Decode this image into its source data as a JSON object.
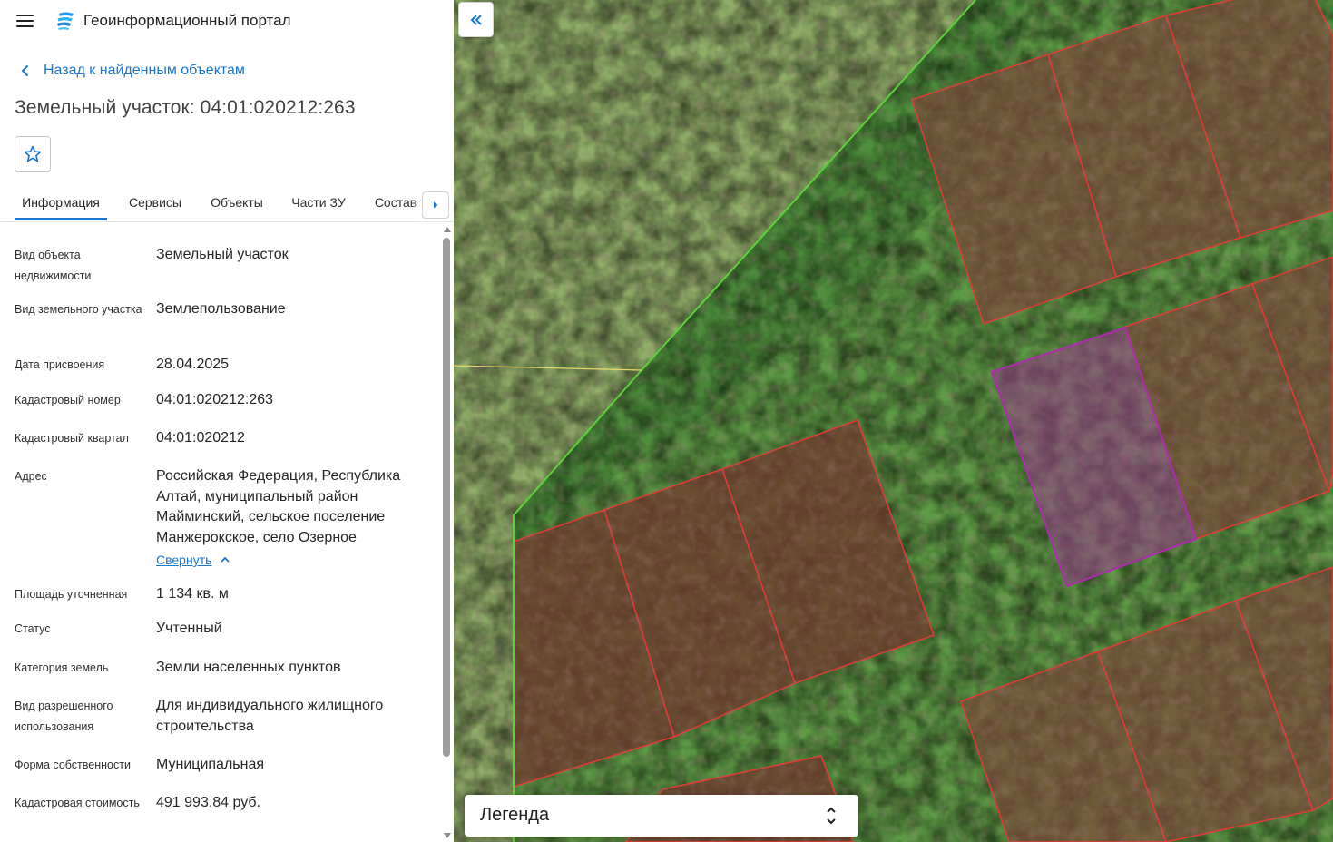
{
  "header": {
    "app_title": "Геоинформационный портал",
    "menu_icon": "hamburger-menu-icon",
    "logo_icon": "portal-logo-icon"
  },
  "nav": {
    "back_label": "Назад к найденным объектам",
    "back_icon": "chevron-left-icon"
  },
  "object": {
    "title": "Земельный участок: 04:01:020212:263",
    "favorite_icon": "star-outline-icon"
  },
  "tabs": [
    {
      "label": "Информация",
      "active": true
    },
    {
      "label": "Сервисы",
      "active": false
    },
    {
      "label": "Объекты",
      "active": false
    },
    {
      "label": "Части ЗУ",
      "active": false
    },
    {
      "label": "Состав",
      "active": false
    }
  ],
  "info": [
    {
      "key": "Вид объекта недвижимости",
      "value": "Земельный участок"
    },
    {
      "key": "Вид земельного участка",
      "value": "Землепользование"
    },
    {
      "key": "Дата присвоения",
      "value": "28.04.2025"
    },
    {
      "key": "Кадастровый номер",
      "value": "04:01:020212:263"
    },
    {
      "key": "Кадастровый квартал",
      "value": "04:01:020212"
    },
    {
      "key": "Адрес",
      "value": "Российская Федерация, Республика Алтай, муниципальный район Майминский, сельское поселение Манжерокское, село Озерное"
    },
    {
      "key": "Площадь уточненная",
      "value": "1 134 кв. м"
    },
    {
      "key": "Статус",
      "value": "Учтенный"
    },
    {
      "key": "Категория земель",
      "value": "Земли населенных пунктов"
    },
    {
      "key": "Вид разрешенного использования",
      "value": "Для индивидуального жилищного строительства"
    },
    {
      "key": "Форма собственности",
      "value": "Муниципальная"
    },
    {
      "key": "Кадастровая стоимость",
      "value": "491 993,84 руб."
    }
  ],
  "address_toggle": {
    "label": "Свернуть",
    "icon": "chevron-up-icon"
  },
  "map": {
    "collapse_icon": "double-chevron-left-icon",
    "legend_label": "Легенда",
    "legend_icon": "unfold-icon",
    "colors": {
      "parcel_border": "#e53935",
      "selected_border": "#b02ab0",
      "zone_border": "#5bd23a",
      "line": "#e8d86a"
    }
  }
}
